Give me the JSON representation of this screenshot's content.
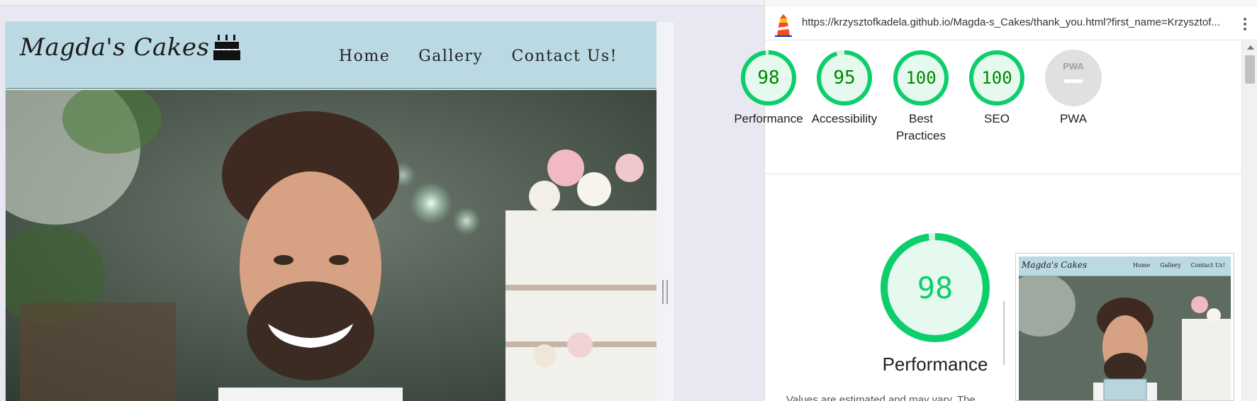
{
  "site": {
    "brand": "Magda's Cakes",
    "nav": [
      "Home",
      "Gallery",
      "Contact Us!"
    ]
  },
  "lighthouse": {
    "url": "https://krzysztofkadela.github.io/Magda-s_Cakes/thank_you.html?first_name=Krzysztof...",
    "scores": [
      {
        "label": "Performance",
        "value": "98",
        "fraction": 0.98
      },
      {
        "label": "Accessibility",
        "value": "95",
        "fraction": 0.95
      },
      {
        "label": "Best Practices",
        "value": "100",
        "fraction": 1.0
      },
      {
        "label": "SEO",
        "value": "100",
        "fraction": 1.0
      },
      {
        "label": "PWA",
        "value": "PWA",
        "fraction": 0
      }
    ],
    "main_score": {
      "label": "Performance",
      "value": "98",
      "fraction": 0.98
    },
    "description": "Values are estimated and may vary. The",
    "thumbnail": {
      "brand": "Magda's Cakes",
      "nav": [
        "Home",
        "Gallery",
        "Contact Us!"
      ]
    }
  },
  "colors": {
    "header_bg": "#bad9e3",
    "score_green": "#0cce6b",
    "score_text": "#008800",
    "pwa_gray": "#e0e0e0"
  }
}
